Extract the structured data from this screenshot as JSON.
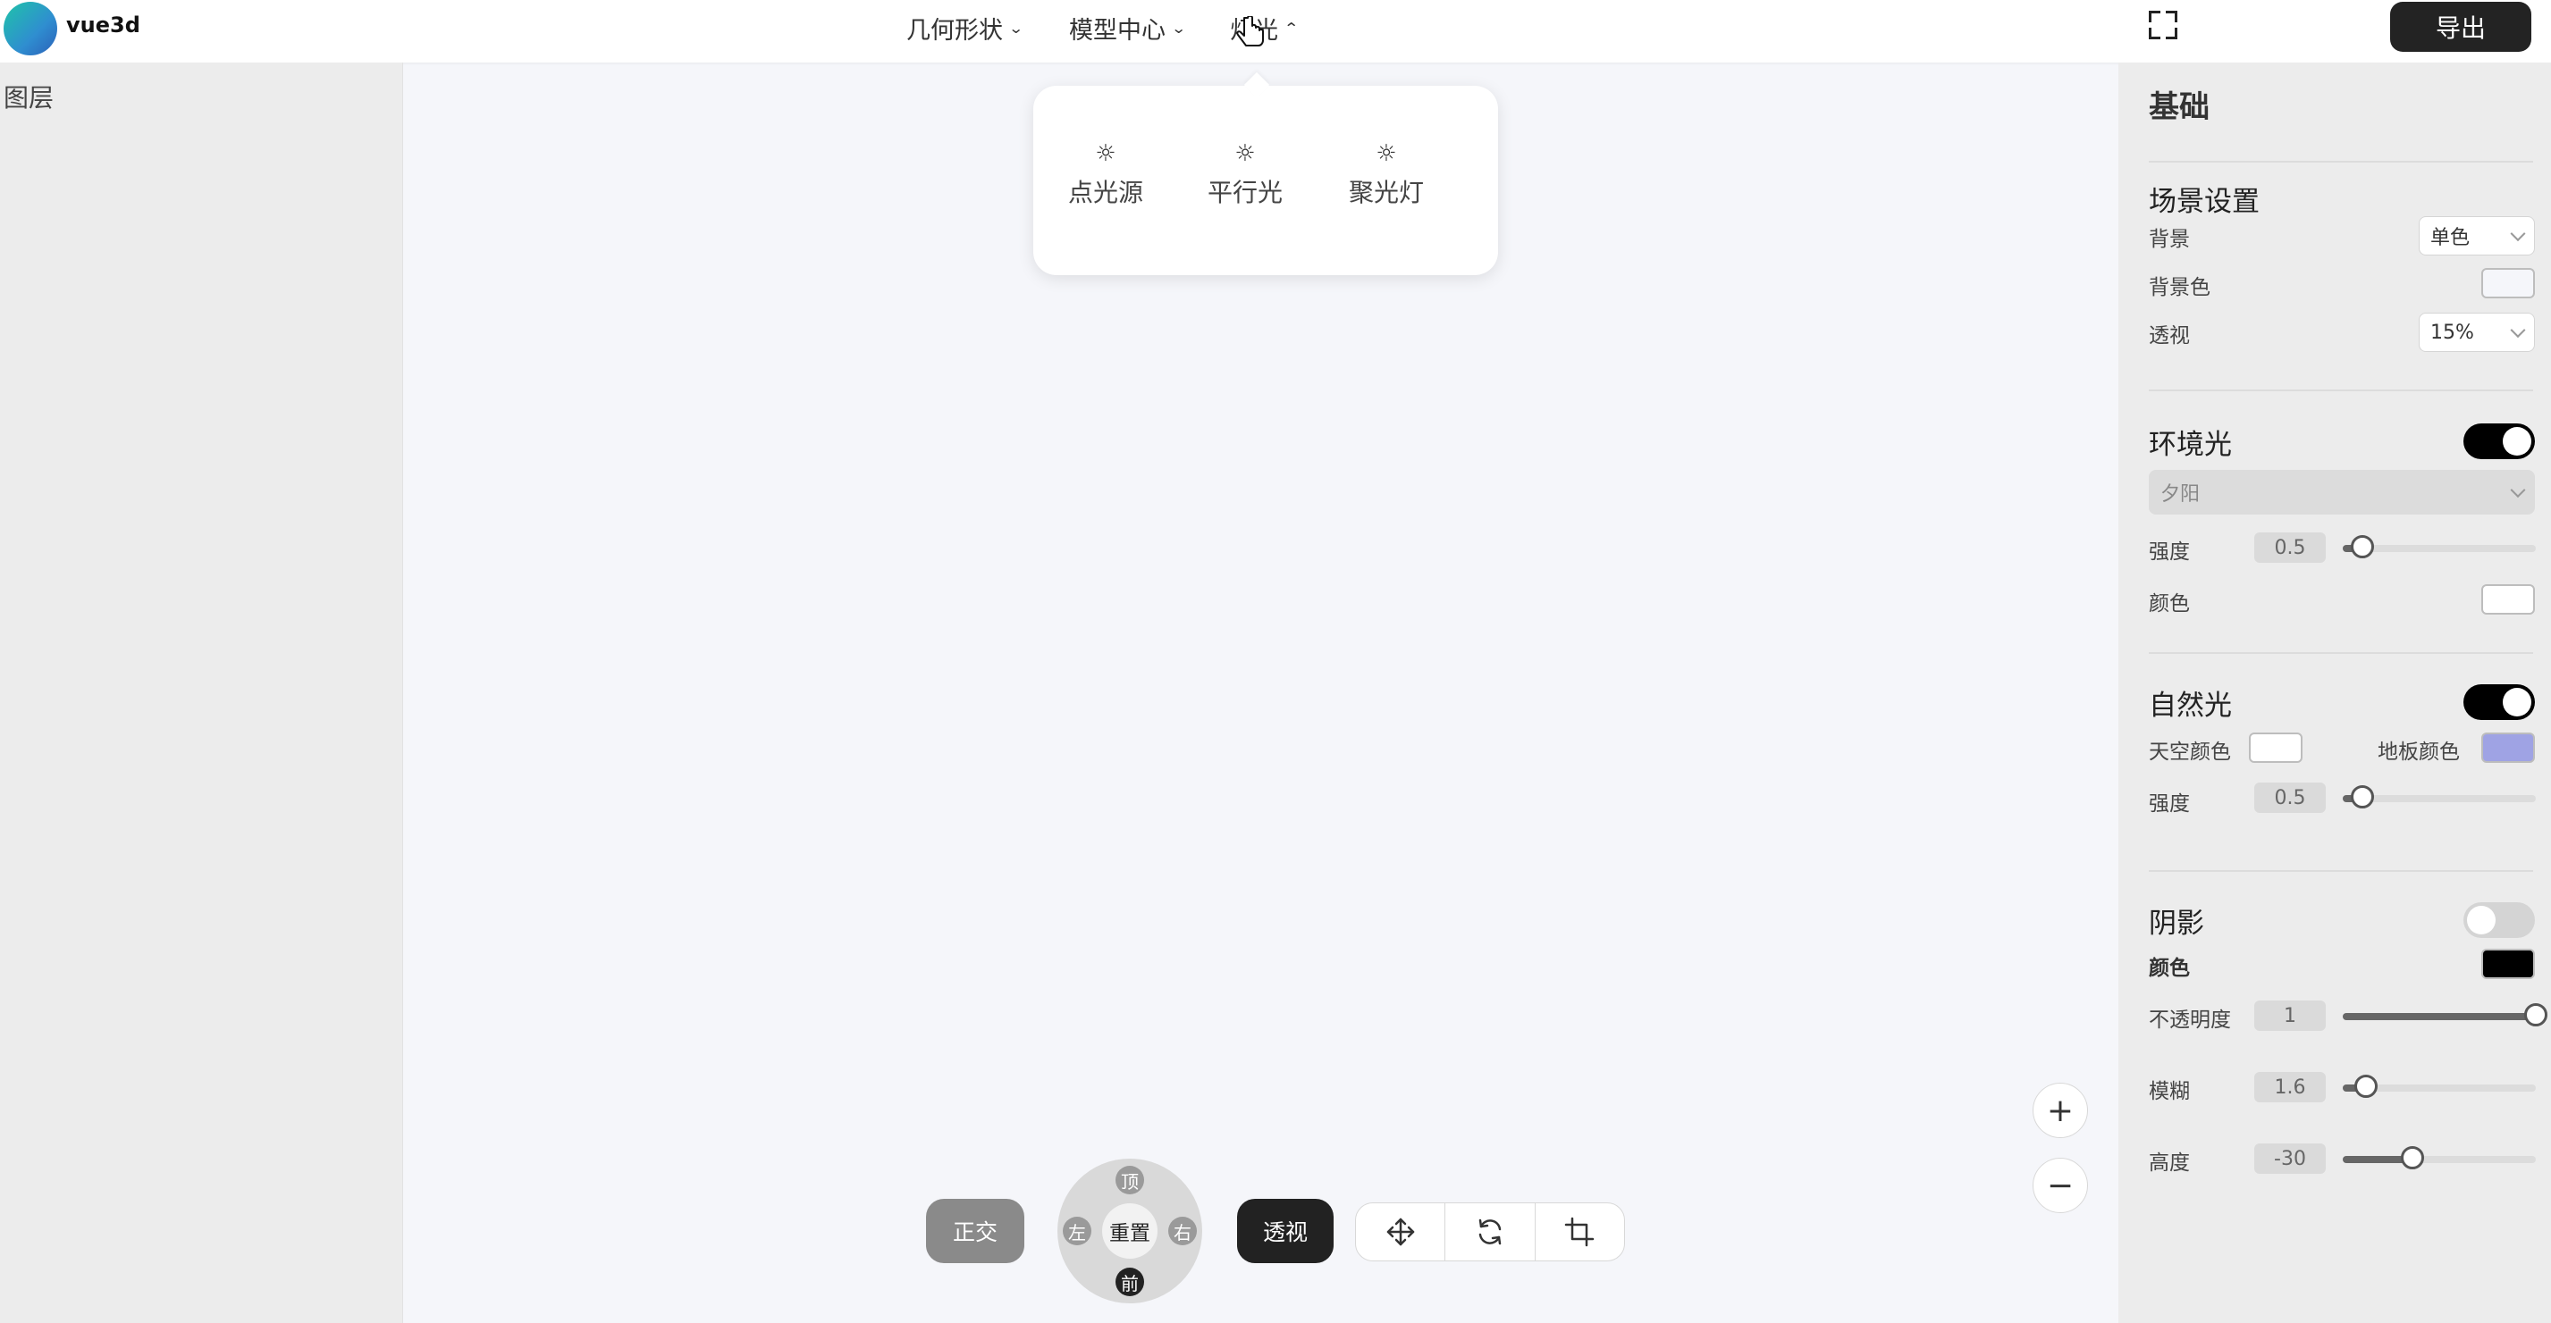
{
  "header": {
    "app_name": "vue3d",
    "menus": [
      {
        "label": "几何形状",
        "chevron": "chevron-down"
      },
      {
        "label": "模型中心",
        "chevron": "chevron-down"
      },
      {
        "label": "灯光",
        "chevron": "chevron-up"
      }
    ],
    "export_label": "导出"
  },
  "layer_panel": {
    "title": "图层"
  },
  "light_dropdown": {
    "options": [
      {
        "icon": "sun-icon",
        "label": "点光源"
      },
      {
        "icon": "sun-icon",
        "label": "平行光"
      },
      {
        "icon": "sun-icon",
        "label": "聚光灯"
      }
    ]
  },
  "toolbar": {
    "ortho_label": "正交",
    "perspective_label": "透视",
    "view_pad": {
      "reset": "重置",
      "top": "顶",
      "front": "前",
      "left": "左",
      "right": "右"
    },
    "tools": [
      "move-icon",
      "rotate-icon",
      "crop-icon"
    ],
    "zoom_in": "+",
    "zoom_out": "−"
  },
  "props": {
    "title": "基础",
    "scene": {
      "title": "场景设置",
      "background_label": "背景",
      "background_value": "单色",
      "bgcolor_label": "背景色",
      "bgcolor": "#f5f6fa",
      "perspective_label": "透视",
      "perspective_value": "15%"
    },
    "ambient": {
      "title": "环境光",
      "enabled": true,
      "preset": "夕阳",
      "intensity_label": "强度",
      "intensity": "0.5",
      "color_label": "颜色",
      "color": "#ffffff"
    },
    "natural": {
      "title": "自然光",
      "enabled": true,
      "sky_label": "天空颜色",
      "sky_color": "#ffffff",
      "ground_label": "地板颜色",
      "ground_color": "#9fa3e4",
      "intensity_label": "强度",
      "intensity": "0.5"
    },
    "shadow": {
      "title": "阴影",
      "enabled": false,
      "color_label": "颜色",
      "color": "#000000",
      "opacity_label": "不透明度",
      "opacity": "1",
      "blur_label": "模糊",
      "blur": "1.6",
      "height_label": "高度",
      "height": "-30"
    }
  },
  "sliders": {
    "ambient_intensity": 0.1,
    "natural_intensity": 0.1,
    "shadow_opacity": 1.0,
    "shadow_blur": 0.12,
    "shadow_height": 0.36
  }
}
